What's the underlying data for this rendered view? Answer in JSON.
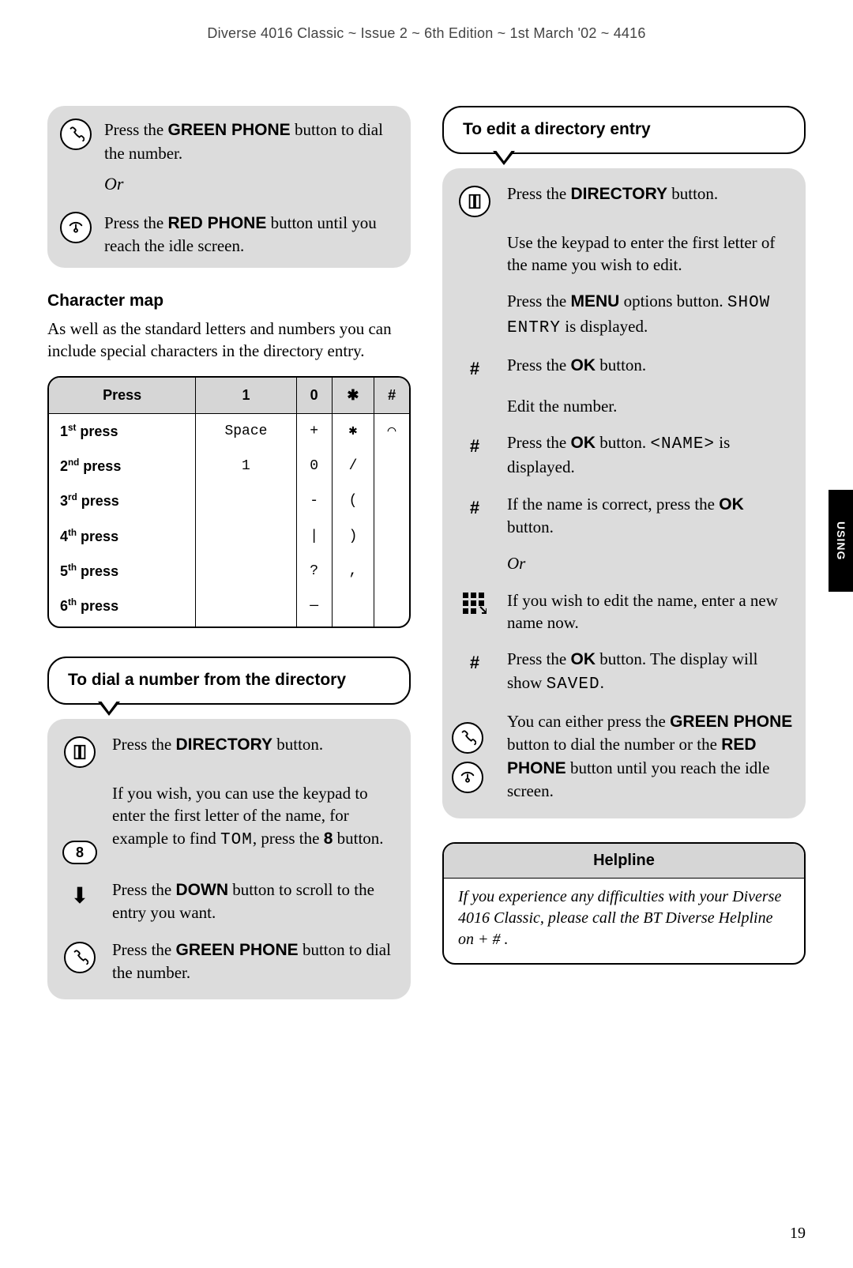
{
  "header": "Diverse 4016 Classic ~ Issue 2 ~ 6th Edition ~ 1st March '02 ~ 4416",
  "side_tab": "USING",
  "page_number": "19",
  "left": {
    "top_block": {
      "green_text_prefix": "Press the ",
      "green_bold": "GREEN PHONE",
      "green_text_suffix": " button to dial the number.",
      "or": "Or",
      "red_text_prefix": "Press the ",
      "red_bold": "RED PHONE",
      "red_text_suffix": " button until you reach the idle screen."
    },
    "charmap": {
      "heading": "Character map",
      "intro": "As well as the standard letters and numbers you can include special characters in the directory entry.",
      "headers": [
        "Press",
        "1",
        "0",
        "✱",
        "#"
      ],
      "rows": [
        {
          "label_pre": "1",
          "label_sup": "st",
          "label_post": " press",
          "cells": [
            "Space",
            "+",
            "✱",
            "⌒"
          ]
        },
        {
          "label_pre": "2",
          "label_sup": "nd",
          "label_post": " press",
          "cells": [
            "1",
            "0",
            "/",
            ""
          ]
        },
        {
          "label_pre": "3",
          "label_sup": "rd",
          "label_post": " press",
          "cells": [
            "",
            "-",
            "(",
            ""
          ]
        },
        {
          "label_pre": "4",
          "label_sup": "th",
          "label_post": " press",
          "cells": [
            "",
            "|",
            ")",
            ""
          ]
        },
        {
          "label_pre": "5",
          "label_sup": "th",
          "label_post": " press",
          "cells": [
            "",
            "?",
            ",",
            ""
          ]
        },
        {
          "label_pre": "6",
          "label_sup": "th",
          "label_post": " press",
          "cells": [
            "",
            "—",
            "",
            ""
          ]
        }
      ]
    },
    "dial_callout": {
      "title": "To dial a number from the directory",
      "steps": {
        "s1_pre": "Press the ",
        "s1_bold": "DIRECTORY",
        "s1_suf": " button.",
        "s2a": "If you wish, you can use the keypad to enter the first letter of the name, for example to find ",
        "s2_lcd": "TOM",
        "s2b": ", press the ",
        "s2_bold": "8",
        "s2c": " button.",
        "eight": "8",
        "s3_pre": "Press the ",
        "s3_bold": "DOWN",
        "s3_suf": " button to scroll to the entry you want.",
        "s4_pre": "Press the ",
        "s4_bold": "GREEN PHONE",
        "s4_suf": " button to dial the number."
      }
    }
  },
  "right": {
    "edit_callout": {
      "title": "To edit a directory entry",
      "s1_pre": "Press the ",
      "s1_bold": "DIRECTORY",
      "s1_suf": " button.",
      "s2": "Use the keypad to enter the first letter of the name you wish to edit.",
      "s3_pre": "Press the ",
      "s3_bold": "MENU",
      "s3_suf": " options button. ",
      "s3_lcd": "SHOW ENTRY",
      "s3_suf2": " is displayed.",
      "s4_pre": "Press the ",
      "s4_bold": "OK",
      "s4_suf": " button.",
      "s5": "Edit the number.",
      "s6_pre": "Press the ",
      "s6_bold": "OK",
      "s6_suf": " button. ",
      "s6_lcd": "<NAME>",
      "s6_suf2": " is displayed.",
      "s7_pre": "If the name is correct, press the ",
      "s7_bold": "OK",
      "s7_suf": " button.",
      "or": "Or",
      "s8": "If you wish to edit the name, enter a new name now.",
      "s9_pre": "Press the ",
      "s9_bold": "OK",
      "s9_suf": " button. The display will show ",
      "s9_lcd": "SAVED",
      "s9_suf2": ".",
      "s10_a": "You can either press the ",
      "s10_bold1": "GREEN PHONE",
      "s10_b": " button to dial the number or the ",
      "s10_bold2": "RED PHONE",
      "s10_c": " button until you reach the idle screen."
    },
    "helpline": {
      "heading": "Helpline",
      "body_a": "If you experience any difficulties with your Diverse 4016 Classic, please call the BT Diverse Helpline on ",
      "body_b": " + # ",
      "body_c": "."
    }
  }
}
